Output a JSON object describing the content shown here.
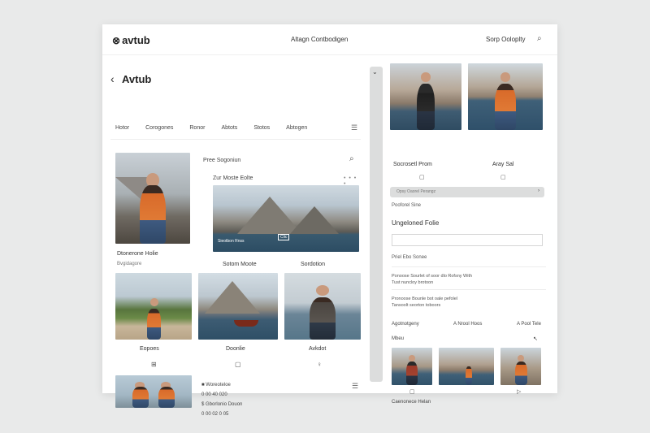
{
  "header": {
    "logo": "avtub",
    "title": "Altagn Contbodigen",
    "right_label": "Sorp Ooloplty"
  },
  "left": {
    "page_title": "Avtub",
    "tabs": [
      "Hotor",
      "Corogones",
      "Ronor",
      "Abtots",
      "Stotos",
      "Abtogen"
    ],
    "hero_caption": "Dtonerone Holie",
    "hero_subcaption": "Bvgidagore",
    "search_label": "Pree Sogoniun",
    "section_label": "Zur Moste Eolte",
    "wide_overlay_left": "Sieotbon Rnss",
    "wide_overlay_right": "Clic",
    "caption_a": "Sotom Moote",
    "caption_b": "Sordotion",
    "row_captions": [
      "Eopoes",
      "Doonlie",
      "Avkdot"
    ],
    "row_icons": [
      "⊞",
      "▢",
      "♀"
    ],
    "list_lines": [
      "Woreoteloe",
      "0 00 40 020",
      "Gborlonio Douon",
      "0 00 02 0 05"
    ]
  },
  "right": {
    "cap_a": "Socrosetl Prom",
    "cap_b": "Aray Sal",
    "bar_text": "Opsy Oaorel Perangz",
    "note": "Pooforel Sine",
    "heading": "Ungeloned Folie",
    "filters_heading": "Priel Ebo Sonee",
    "para_1": [
      "Ponoose Sourlet of soor dlo Rofsny With",
      "Tust nuncloy brotoon"
    ],
    "para_2": [
      "Pronoose Bounle bot oale pefolel",
      "Tansoolt seorton toboors"
    ],
    "filters": [
      "Agotnotgeny",
      "A Nrool Hoos",
      "A Pool Tele"
    ],
    "filter_label": "Mbeu",
    "sort_icon": "↖",
    "bottom_icons": [
      "▢",
      "▷"
    ],
    "footer": "Caenonece Helan"
  }
}
